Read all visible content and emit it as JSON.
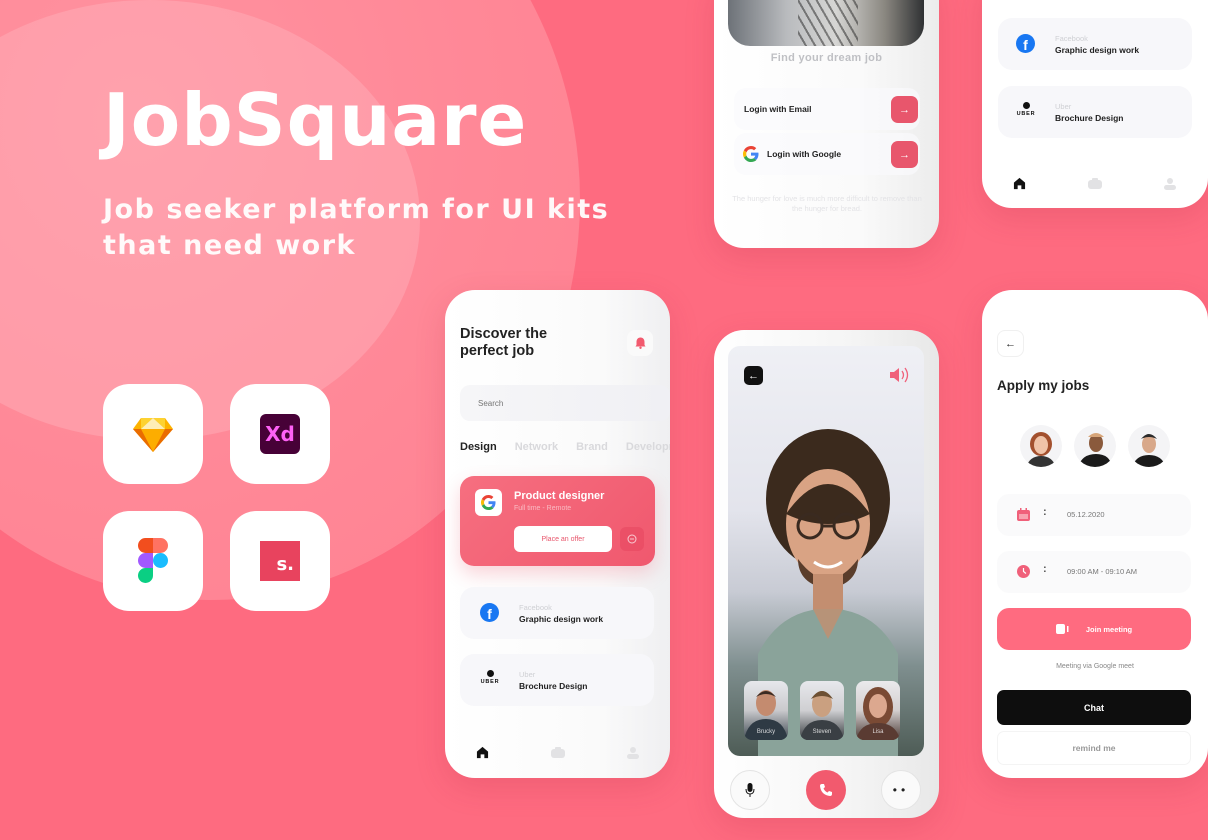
{
  "hero": {
    "title": "JobSquare",
    "subtitle": "Job seeker platform for UI kits that need work"
  },
  "tools": [
    {
      "name": "Sketch",
      "icon": "sketch-icon"
    },
    {
      "name": "Adobe XD",
      "icon": "xd-icon",
      "label": "Xd"
    },
    {
      "name": "Figma",
      "icon": "figma-icon"
    },
    {
      "name": "Studio",
      "icon": "studio-icon",
      "label": "s."
    }
  ],
  "colors": {
    "background": "#fe6b80",
    "accent": "#f0586e",
    "dark": "#0e0e0e"
  },
  "login_screen": {
    "title": "Find your dream job",
    "email_label": "Login with Email",
    "google_label": "Login with Google",
    "quote": "The hunger for love is much more difficult to remove than the hunger for bread."
  },
  "list_screen_top": {
    "jobs": [
      {
        "company": "Facebook",
        "title": "Graphic design work"
      },
      {
        "company": "Uber",
        "title": "Brochure Design"
      }
    ]
  },
  "discover_screen": {
    "title_line1": "Discover the",
    "title_line2": "perfect job",
    "search_placeholder": "Search",
    "tabs": [
      "Design",
      "Network",
      "Brand",
      "Development"
    ],
    "active_tab": "Design",
    "featured": {
      "company": "Google",
      "title": "Product designer",
      "subtitle": "Full time - Remote",
      "button": "Place an offer"
    },
    "jobs": [
      {
        "company": "Facebook",
        "title": "Graphic design work"
      },
      {
        "company": "Uber",
        "title": "Brochure Design"
      }
    ],
    "uber_wordmark": "UBER"
  },
  "call_screen": {
    "participants": [
      "Brucky",
      "Steven",
      "Lisa"
    ]
  },
  "apply_screen": {
    "title": "Apply my jobs",
    "date": "05.12.2020",
    "time": "09:00 AM - 09:10 AM",
    "join_label": "Join meeting",
    "meeting_note": "Meeting via Google meet",
    "chat_label": "Chat",
    "remind_label": "remind me"
  }
}
